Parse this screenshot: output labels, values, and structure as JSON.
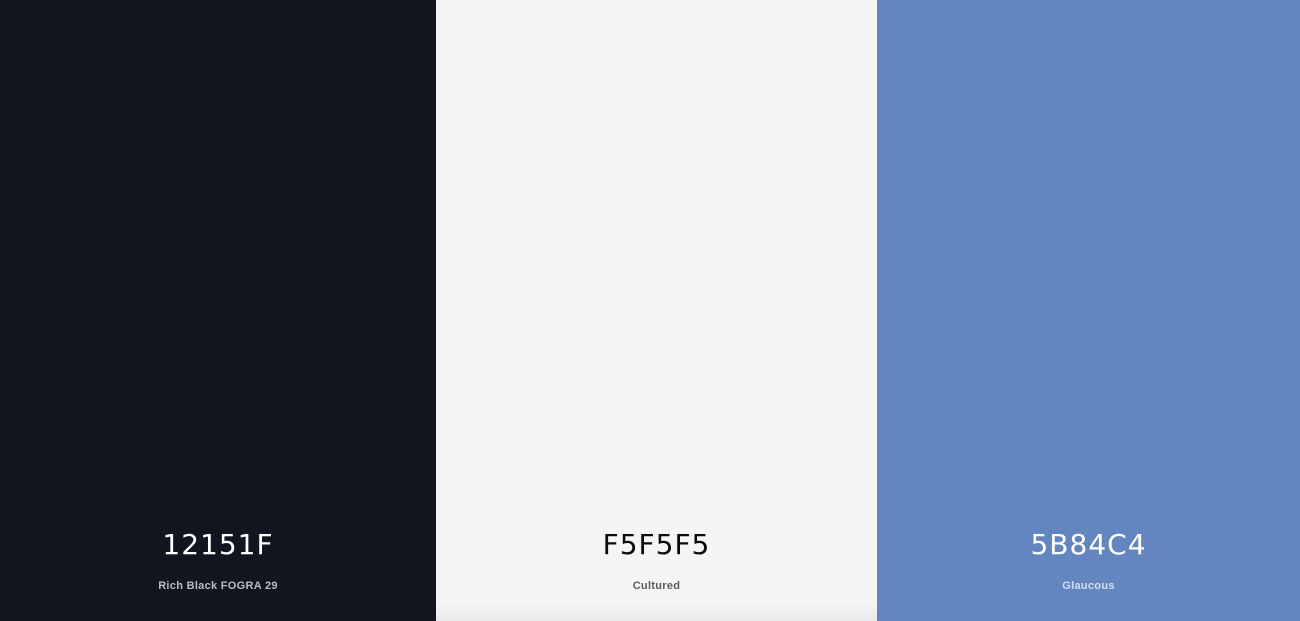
{
  "swatches": [
    {
      "hex": "12151F",
      "name": "Rich Black FOGRA 29",
      "color": "#12151F"
    },
    {
      "hex": "F5F5F5",
      "name": "Cultured",
      "color": "#F5F5F5"
    },
    {
      "hex": "5B84C4",
      "name": "Glaucous",
      "color": "#6385C0"
    }
  ]
}
